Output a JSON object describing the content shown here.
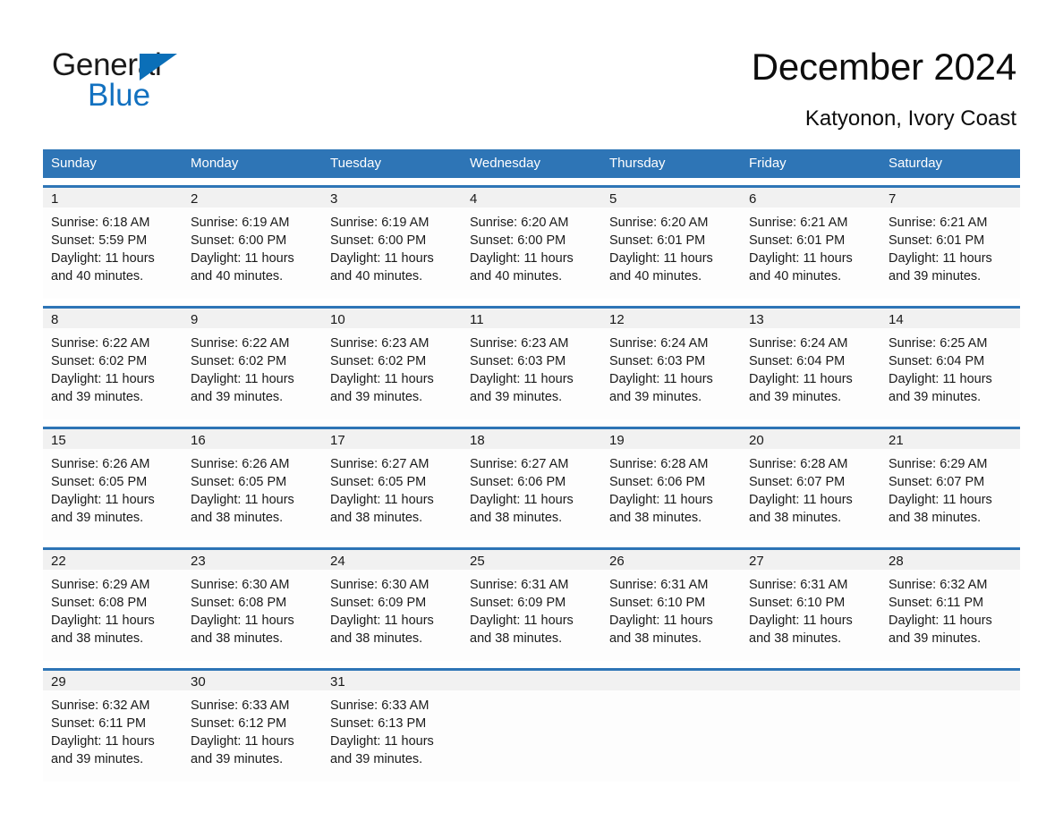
{
  "logo": {
    "word_general": "General",
    "word_blue": "Blue",
    "triangle_color": "#0b6fb8",
    "blue_text_color": "#1271c0"
  },
  "header": {
    "title": "December 2024",
    "subtitle": "Katyonon, Ivory Coast"
  },
  "theme": {
    "header_blue": "#2e75b6",
    "daynum_band": "#f1f1f1",
    "text": "#1a1a1a"
  },
  "weekdays": [
    "Sunday",
    "Monday",
    "Tuesday",
    "Wednesday",
    "Thursday",
    "Friday",
    "Saturday"
  ],
  "weeks": [
    [
      {
        "day": "1",
        "sunrise": "Sunrise: 6:18 AM",
        "sunset": "Sunset: 5:59 PM",
        "daylight_1": "Daylight: 11 hours",
        "daylight_2": "and 40 minutes."
      },
      {
        "day": "2",
        "sunrise": "Sunrise: 6:19 AM",
        "sunset": "Sunset: 6:00 PM",
        "daylight_1": "Daylight: 11 hours",
        "daylight_2": "and 40 minutes."
      },
      {
        "day": "3",
        "sunrise": "Sunrise: 6:19 AM",
        "sunset": "Sunset: 6:00 PM",
        "daylight_1": "Daylight: 11 hours",
        "daylight_2": "and 40 minutes."
      },
      {
        "day": "4",
        "sunrise": "Sunrise: 6:20 AM",
        "sunset": "Sunset: 6:00 PM",
        "daylight_1": "Daylight: 11 hours",
        "daylight_2": "and 40 minutes."
      },
      {
        "day": "5",
        "sunrise": "Sunrise: 6:20 AM",
        "sunset": "Sunset: 6:01 PM",
        "daylight_1": "Daylight: 11 hours",
        "daylight_2": "and 40 minutes."
      },
      {
        "day": "6",
        "sunrise": "Sunrise: 6:21 AM",
        "sunset": "Sunset: 6:01 PM",
        "daylight_1": "Daylight: 11 hours",
        "daylight_2": "and 40 minutes."
      },
      {
        "day": "7",
        "sunrise": "Sunrise: 6:21 AM",
        "sunset": "Sunset: 6:01 PM",
        "daylight_1": "Daylight: 11 hours",
        "daylight_2": "and 39 minutes."
      }
    ],
    [
      {
        "day": "8",
        "sunrise": "Sunrise: 6:22 AM",
        "sunset": "Sunset: 6:02 PM",
        "daylight_1": "Daylight: 11 hours",
        "daylight_2": "and 39 minutes."
      },
      {
        "day": "9",
        "sunrise": "Sunrise: 6:22 AM",
        "sunset": "Sunset: 6:02 PM",
        "daylight_1": "Daylight: 11 hours",
        "daylight_2": "and 39 minutes."
      },
      {
        "day": "10",
        "sunrise": "Sunrise: 6:23 AM",
        "sunset": "Sunset: 6:02 PM",
        "daylight_1": "Daylight: 11 hours",
        "daylight_2": "and 39 minutes."
      },
      {
        "day": "11",
        "sunrise": "Sunrise: 6:23 AM",
        "sunset": "Sunset: 6:03 PM",
        "daylight_1": "Daylight: 11 hours",
        "daylight_2": "and 39 minutes."
      },
      {
        "day": "12",
        "sunrise": "Sunrise: 6:24 AM",
        "sunset": "Sunset: 6:03 PM",
        "daylight_1": "Daylight: 11 hours",
        "daylight_2": "and 39 minutes."
      },
      {
        "day": "13",
        "sunrise": "Sunrise: 6:24 AM",
        "sunset": "Sunset: 6:04 PM",
        "daylight_1": "Daylight: 11 hours",
        "daylight_2": "and 39 minutes."
      },
      {
        "day": "14",
        "sunrise": "Sunrise: 6:25 AM",
        "sunset": "Sunset: 6:04 PM",
        "daylight_1": "Daylight: 11 hours",
        "daylight_2": "and 39 minutes."
      }
    ],
    [
      {
        "day": "15",
        "sunrise": "Sunrise: 6:26 AM",
        "sunset": "Sunset: 6:05 PM",
        "daylight_1": "Daylight: 11 hours",
        "daylight_2": "and 39 minutes."
      },
      {
        "day": "16",
        "sunrise": "Sunrise: 6:26 AM",
        "sunset": "Sunset: 6:05 PM",
        "daylight_1": "Daylight: 11 hours",
        "daylight_2": "and 38 minutes."
      },
      {
        "day": "17",
        "sunrise": "Sunrise: 6:27 AM",
        "sunset": "Sunset: 6:05 PM",
        "daylight_1": "Daylight: 11 hours",
        "daylight_2": "and 38 minutes."
      },
      {
        "day": "18",
        "sunrise": "Sunrise: 6:27 AM",
        "sunset": "Sunset: 6:06 PM",
        "daylight_1": "Daylight: 11 hours",
        "daylight_2": "and 38 minutes."
      },
      {
        "day": "19",
        "sunrise": "Sunrise: 6:28 AM",
        "sunset": "Sunset: 6:06 PM",
        "daylight_1": "Daylight: 11 hours",
        "daylight_2": "and 38 minutes."
      },
      {
        "day": "20",
        "sunrise": "Sunrise: 6:28 AM",
        "sunset": "Sunset: 6:07 PM",
        "daylight_1": "Daylight: 11 hours",
        "daylight_2": "and 38 minutes."
      },
      {
        "day": "21",
        "sunrise": "Sunrise: 6:29 AM",
        "sunset": "Sunset: 6:07 PM",
        "daylight_1": "Daylight: 11 hours",
        "daylight_2": "and 38 minutes."
      }
    ],
    [
      {
        "day": "22",
        "sunrise": "Sunrise: 6:29 AM",
        "sunset": "Sunset: 6:08 PM",
        "daylight_1": "Daylight: 11 hours",
        "daylight_2": "and 38 minutes."
      },
      {
        "day": "23",
        "sunrise": "Sunrise: 6:30 AM",
        "sunset": "Sunset: 6:08 PM",
        "daylight_1": "Daylight: 11 hours",
        "daylight_2": "and 38 minutes."
      },
      {
        "day": "24",
        "sunrise": "Sunrise: 6:30 AM",
        "sunset": "Sunset: 6:09 PM",
        "daylight_1": "Daylight: 11 hours",
        "daylight_2": "and 38 minutes."
      },
      {
        "day": "25",
        "sunrise": "Sunrise: 6:31 AM",
        "sunset": "Sunset: 6:09 PM",
        "daylight_1": "Daylight: 11 hours",
        "daylight_2": "and 38 minutes."
      },
      {
        "day": "26",
        "sunrise": "Sunrise: 6:31 AM",
        "sunset": "Sunset: 6:10 PM",
        "daylight_1": "Daylight: 11 hours",
        "daylight_2": "and 38 minutes."
      },
      {
        "day": "27",
        "sunrise": "Sunrise: 6:31 AM",
        "sunset": "Sunset: 6:10 PM",
        "daylight_1": "Daylight: 11 hours",
        "daylight_2": "and 38 minutes."
      },
      {
        "day": "28",
        "sunrise": "Sunrise: 6:32 AM",
        "sunset": "Sunset: 6:11 PM",
        "daylight_1": "Daylight: 11 hours",
        "daylight_2": "and 39 minutes."
      }
    ],
    [
      {
        "day": "29",
        "sunrise": "Sunrise: 6:32 AM",
        "sunset": "Sunset: 6:11 PM",
        "daylight_1": "Daylight: 11 hours",
        "daylight_2": "and 39 minutes."
      },
      {
        "day": "30",
        "sunrise": "Sunrise: 6:33 AM",
        "sunset": "Sunset: 6:12 PM",
        "daylight_1": "Daylight: 11 hours",
        "daylight_2": "and 39 minutes."
      },
      {
        "day": "31",
        "sunrise": "Sunrise: 6:33 AM",
        "sunset": "Sunset: 6:13 PM",
        "daylight_1": "Daylight: 11 hours",
        "daylight_2": "and 39 minutes."
      },
      {
        "day": "",
        "sunrise": "",
        "sunset": "",
        "daylight_1": "",
        "daylight_2": ""
      },
      {
        "day": "",
        "sunrise": "",
        "sunset": "",
        "daylight_1": "",
        "daylight_2": ""
      },
      {
        "day": "",
        "sunrise": "",
        "sunset": "",
        "daylight_1": "",
        "daylight_2": ""
      },
      {
        "day": "",
        "sunrise": "",
        "sunset": "",
        "daylight_1": "",
        "daylight_2": ""
      }
    ]
  ]
}
